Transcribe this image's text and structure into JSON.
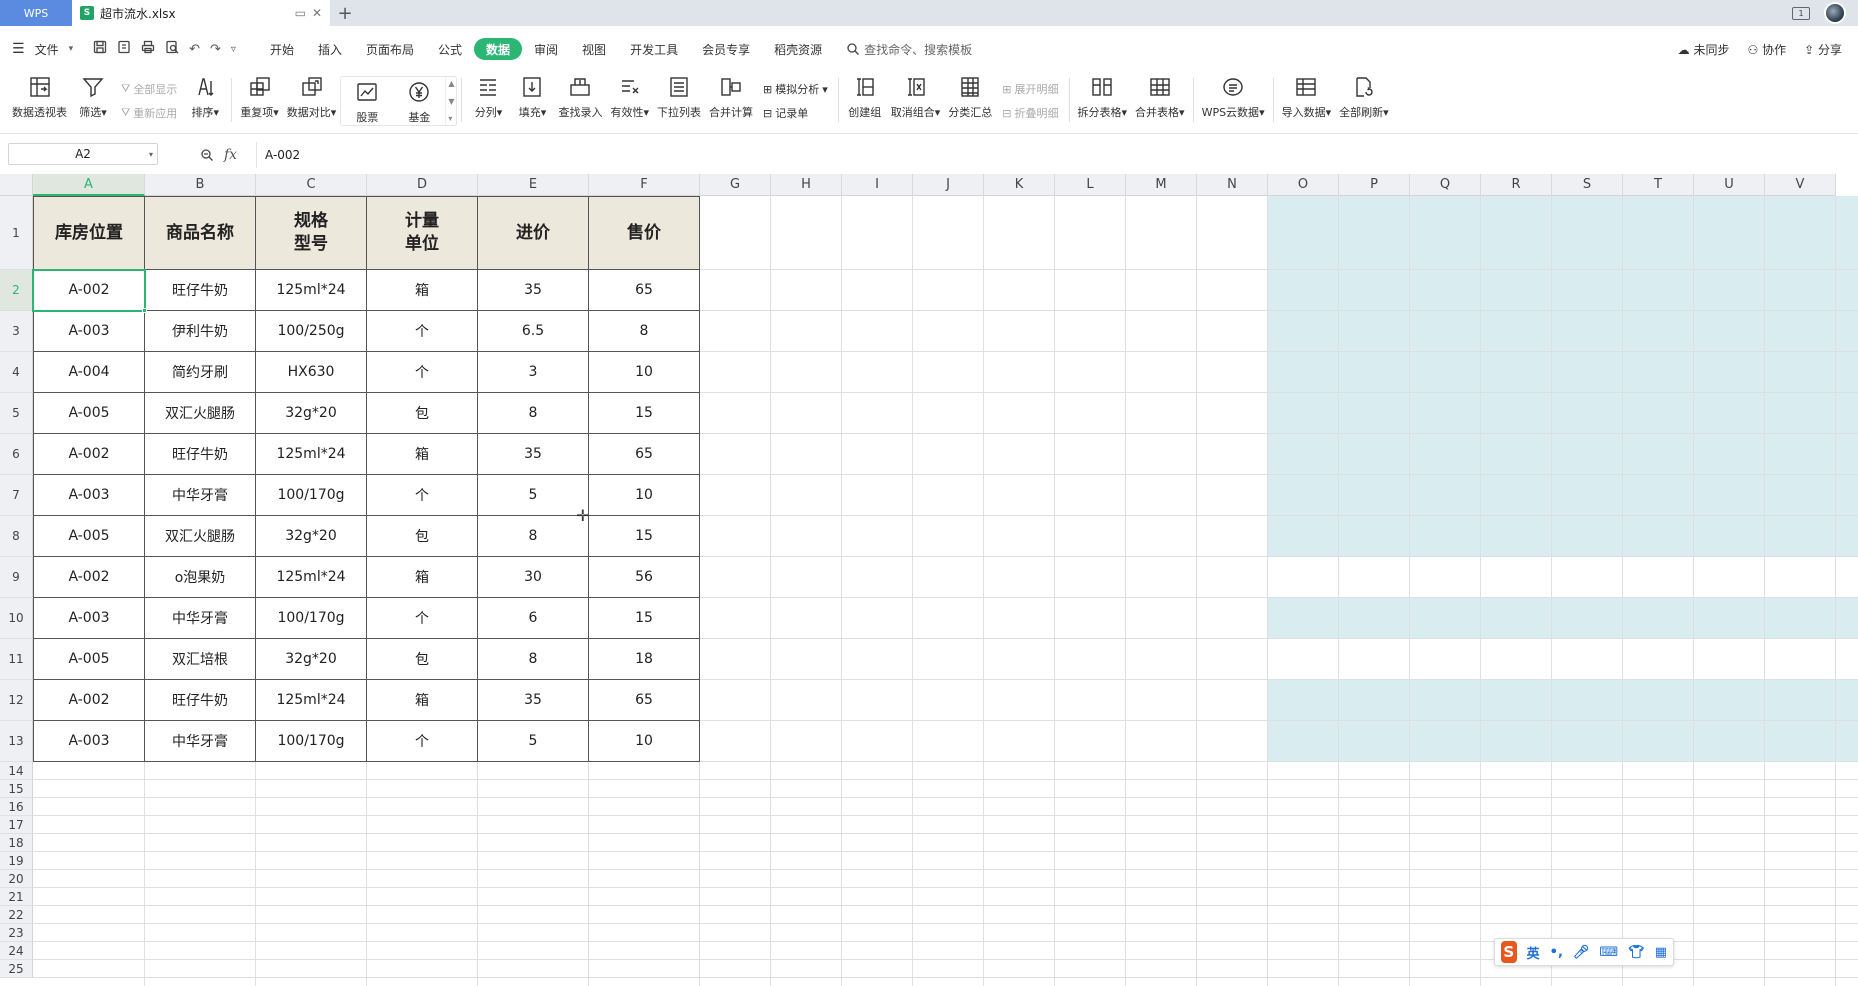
{
  "tabs": {
    "app": "WPS",
    "file": "超市流水.xlsx",
    "file_badge": "S"
  },
  "quick_menu": {
    "file": "文件"
  },
  "menu_tabs": [
    "开始",
    "插入",
    "页面布局",
    "公式",
    "数据",
    "审阅",
    "视图",
    "开发工具",
    "会员专享",
    "稻壳资源"
  ],
  "active_menu": "数据",
  "search_placeholder": "查找命令、搜索模板",
  "menu_right": [
    "未同步",
    "协作",
    "分享"
  ],
  "ribbon": {
    "pivot": "数据透视表",
    "filter": "筛选",
    "show_all": "全部显示",
    "reapply": "重新应用",
    "sort": "排序",
    "duplicates": "重复项",
    "compare": "数据对比",
    "stock": "股票",
    "fund": "基金",
    "split": "分列",
    "fill": "填充",
    "lookup": "查找录入",
    "validity": "有效性",
    "dropdown": "下拉列表",
    "consolidate": "合并计算",
    "simulate": "模拟分析",
    "record": "记录单",
    "group": "创建组",
    "ungroup": "取消组合",
    "subtotal": "分类汇总",
    "expand": "展开明细",
    "collapse": "折叠明细",
    "split_table": "拆分表格",
    "merge_table": "合并表格",
    "cloud": "WPS云数据",
    "import": "导入数据",
    "refresh": "全部刷新"
  },
  "formula_bar": {
    "name_box": "A2",
    "fx": "fx",
    "value": "A-002"
  },
  "columns": [
    "A",
    "B",
    "C",
    "D",
    "E",
    "F",
    "G",
    "H",
    "I",
    "J",
    "K",
    "L",
    "M",
    "N",
    "O",
    "P",
    "Q",
    "R",
    "S",
    "T",
    "U",
    "V"
  ],
  "rows": [
    "1",
    "2",
    "3",
    "4",
    "5",
    "6",
    "7",
    "8",
    "9",
    "10",
    "11",
    "12",
    "13",
    "14",
    "15",
    "16",
    "17",
    "18",
    "19",
    "20",
    "21",
    "22",
    "23",
    "24",
    "25"
  ],
  "table": {
    "headers": [
      "库房位置",
      "商品名称",
      "规格\n型号",
      "计量\n单位",
      "进价",
      "售价"
    ],
    "data": [
      [
        "A-002",
        "旺仔牛奶",
        "125ml*24",
        "箱",
        "35",
        "65"
      ],
      [
        "A-003",
        "伊利牛奶",
        "100/250g",
        "个",
        "6.5",
        "8"
      ],
      [
        "A-004",
        "简约牙刷",
        "HX630",
        "个",
        "3",
        "10"
      ],
      [
        "A-005",
        "双汇火腿肠",
        "32g*20",
        "包",
        "8",
        "15"
      ],
      [
        "A-002",
        "旺仔牛奶",
        "125ml*24",
        "箱",
        "35",
        "65"
      ],
      [
        "A-003",
        "中华牙膏",
        "100/170g",
        "个",
        "5",
        "10"
      ],
      [
        "A-005",
        "双汇火腿肠",
        "32g*20",
        "包",
        "8",
        "15"
      ],
      [
        "A-002",
        "o泡果奶",
        "125ml*24",
        "箱",
        "30",
        "56"
      ],
      [
        "A-003",
        "中华牙膏",
        "100/170g",
        "个",
        "6",
        "15"
      ],
      [
        "A-005",
        "双汇培根",
        "32g*20",
        "包",
        "8",
        "18"
      ],
      [
        "A-002",
        "旺仔牛奶",
        "125ml*24",
        "箱",
        "35",
        "65"
      ],
      [
        "A-003",
        "中华牙膏",
        "100/170g",
        "个",
        "5",
        "10"
      ]
    ]
  },
  "ime": {
    "logo": "S",
    "mode": "英"
  },
  "colors": {
    "accent": "#2bb673",
    "header_fill": "#ede8dc",
    "shade": "#d9ecef"
  }
}
